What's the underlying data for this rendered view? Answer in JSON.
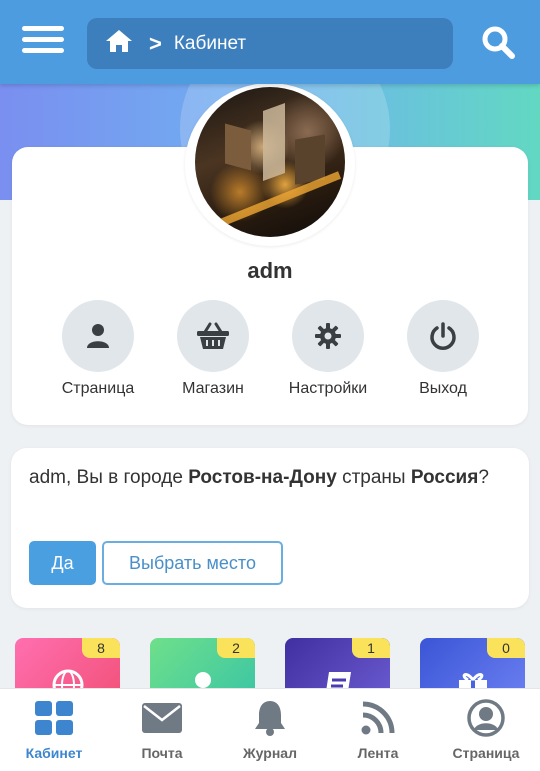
{
  "header": {
    "breadcrumb_title": "Кабинет",
    "breadcrumb_separator": ">",
    "icons": [
      "menu-icon",
      "home-icon",
      "search-icon"
    ],
    "accent_color": "#4e9ce0"
  },
  "profile": {
    "username": "adm",
    "actions": [
      {
        "label": "Страница",
        "icon": "user-icon"
      },
      {
        "label": "Магазин",
        "icon": "basket-icon"
      },
      {
        "label": "Настройки",
        "icon": "gear-icon"
      },
      {
        "label": "Выход",
        "icon": "power-icon"
      }
    ]
  },
  "city_prompt": {
    "prefix": "adm, Вы в городе ",
    "city": "Ростов-на-Дону",
    "middle": " страны ",
    "country": "Россия",
    "suffix": "?",
    "yes_label": "Да",
    "choose_label": "Выбрать место"
  },
  "tiles": [
    {
      "badge": "8",
      "icon": "globe-icon"
    },
    {
      "badge": "2",
      "icon": "user-icon"
    },
    {
      "badge": "1",
      "icon": "document-icon"
    },
    {
      "badge": "0",
      "icon": "gift-icon"
    }
  ],
  "bottom_nav": [
    {
      "label": "Кабинет",
      "icon": "grid-icon",
      "active": true
    },
    {
      "label": "Почта",
      "icon": "mail-icon",
      "active": false
    },
    {
      "label": "Журнал",
      "icon": "bell-icon",
      "active": false
    },
    {
      "label": "Лента",
      "icon": "rss-icon",
      "active": false
    },
    {
      "label": "Страница",
      "icon": "user-circle-icon",
      "active": false
    }
  ]
}
